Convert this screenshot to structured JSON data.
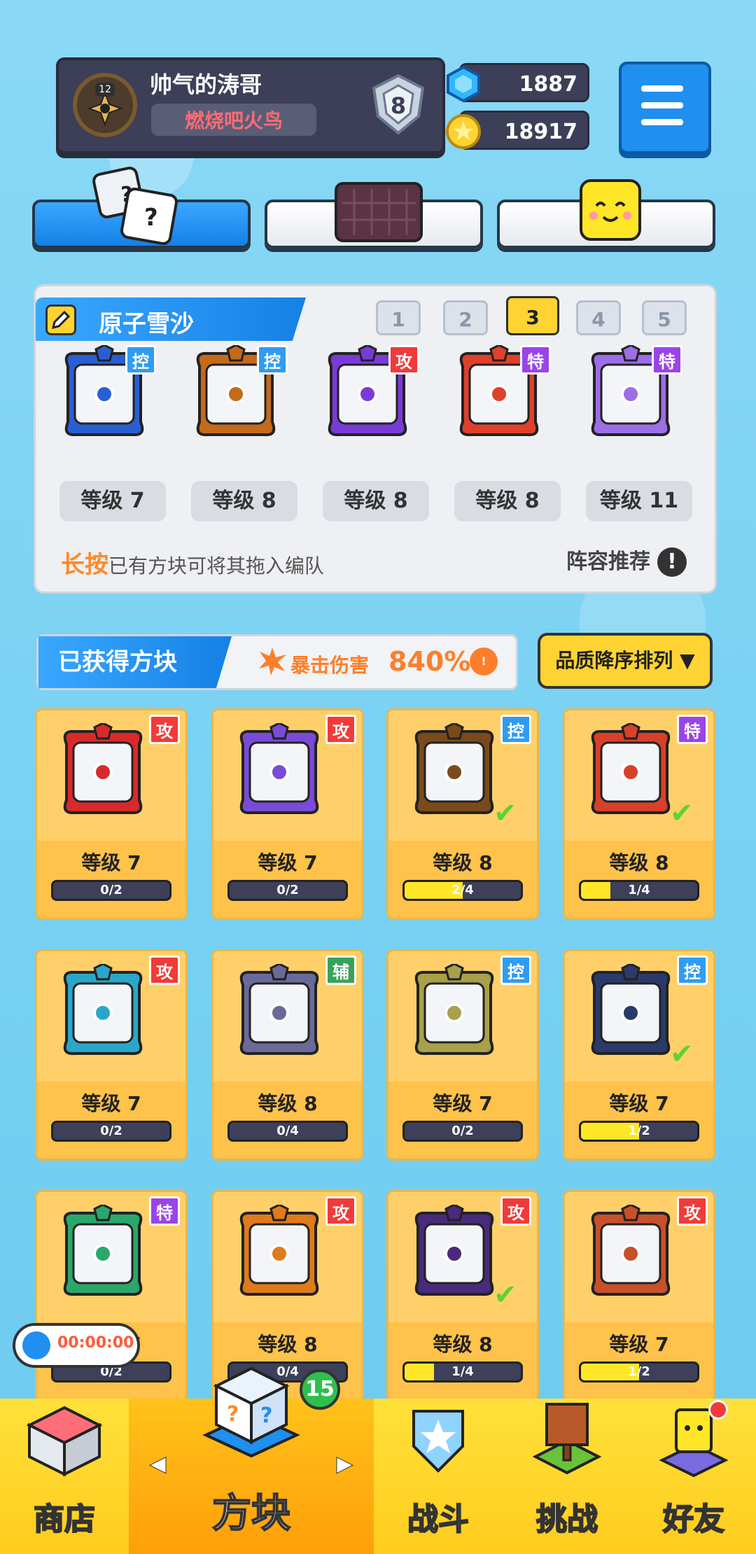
{
  "profile": {
    "name": "帅气的涛哥",
    "title": "燃烧吧火鸟",
    "avatar_level": "12",
    "rank": "8"
  },
  "currency": {
    "gems": "1887",
    "coins": "18917"
  },
  "lineup": {
    "deck_name": "原子雪沙",
    "pages": [
      "1",
      "2",
      "3",
      "4",
      "5"
    ],
    "selected_page": "3",
    "slots": [
      {
        "level": "等级 7",
        "tag": "控",
        "color": "#2a5fd3"
      },
      {
        "level": "等级 8",
        "tag": "控",
        "color": "#c46a1a"
      },
      {
        "level": "等级 8",
        "tag": "攻",
        "color": "#7a3ad8"
      },
      {
        "level": "等级 8",
        "tag": "特",
        "color": "#e0402a"
      },
      {
        "level": "等级 11",
        "tag": "特",
        "color": "#9c6ee8"
      }
    ],
    "hint_prefix": "长按",
    "hint_rest": "已有方块可将其拖入编队",
    "recommend": "阵容推荐",
    "recommend_icon": "!"
  },
  "owned": {
    "label": "已获得方块",
    "crit_label": "暴击伤害",
    "crit_value": "840%",
    "crit_icon": "!",
    "sort_label": "品质降序排列 ▼",
    "cards": [
      {
        "level": "等级 7",
        "progress": "0/2",
        "fill": 0.0,
        "tag": "攻",
        "tagcls": "atk",
        "color": "#d82a2a",
        "check": false
      },
      {
        "level": "等级 7",
        "progress": "0/2",
        "fill": 0.0,
        "tag": "攻",
        "tagcls": "atk",
        "color": "#7a4ad8",
        "check": false
      },
      {
        "level": "等级 8",
        "progress": "2/4",
        "fill": 0.5,
        "tag": "控",
        "tagcls": "ctl",
        "color": "#7a4a1a",
        "check": true
      },
      {
        "level": "等级 8",
        "progress": "1/4",
        "fill": 0.25,
        "tag": "特",
        "tagcls": "spc",
        "color": "#d8402a",
        "check": true
      },
      {
        "level": "等级 7",
        "progress": "0/2",
        "fill": 0.0,
        "tag": "攻",
        "tagcls": "atk",
        "color": "#2aa7c8",
        "check": false
      },
      {
        "level": "等级 8",
        "progress": "0/4",
        "fill": 0.0,
        "tag": "辅",
        "tagcls": "sup",
        "color": "#6a6a9a",
        "check": false
      },
      {
        "level": "等级 7",
        "progress": "0/2",
        "fill": 0.0,
        "tag": "控",
        "tagcls": "ctl",
        "color": "#a8a04a",
        "check": false
      },
      {
        "level": "等级 7",
        "progress": "1/2",
        "fill": 0.5,
        "tag": "控",
        "tagcls": "ctl",
        "color": "#2a3a6a",
        "check": true
      },
      {
        "level": "等级 7",
        "progress": "0/2",
        "fill": 0.0,
        "tag": "特",
        "tagcls": "spc",
        "color": "#2aa86a",
        "check": false
      },
      {
        "level": "等级 8",
        "progress": "0/4",
        "fill": 0.0,
        "tag": "攻",
        "tagcls": "atk",
        "color": "#e07a1a",
        "check": false
      },
      {
        "level": "等级 8",
        "progress": "1/4",
        "fill": 0.25,
        "tag": "攻",
        "tagcls": "atk",
        "color": "#4a2a7a",
        "check": true
      },
      {
        "level": "等级 7",
        "progress": "1/2",
        "fill": 0.5,
        "tag": "攻",
        "tagcls": "atk",
        "color": "#c8502a",
        "check": false
      }
    ]
  },
  "timer": {
    "value": "00:00:00"
  },
  "nav": {
    "items": [
      {
        "label": "商店"
      },
      {
        "label": "方块",
        "badge": "15"
      },
      {
        "label": "战斗"
      },
      {
        "label": "挑战"
      },
      {
        "label": "好友"
      }
    ],
    "left_arrow": "◀",
    "right_arrow": "▶"
  }
}
